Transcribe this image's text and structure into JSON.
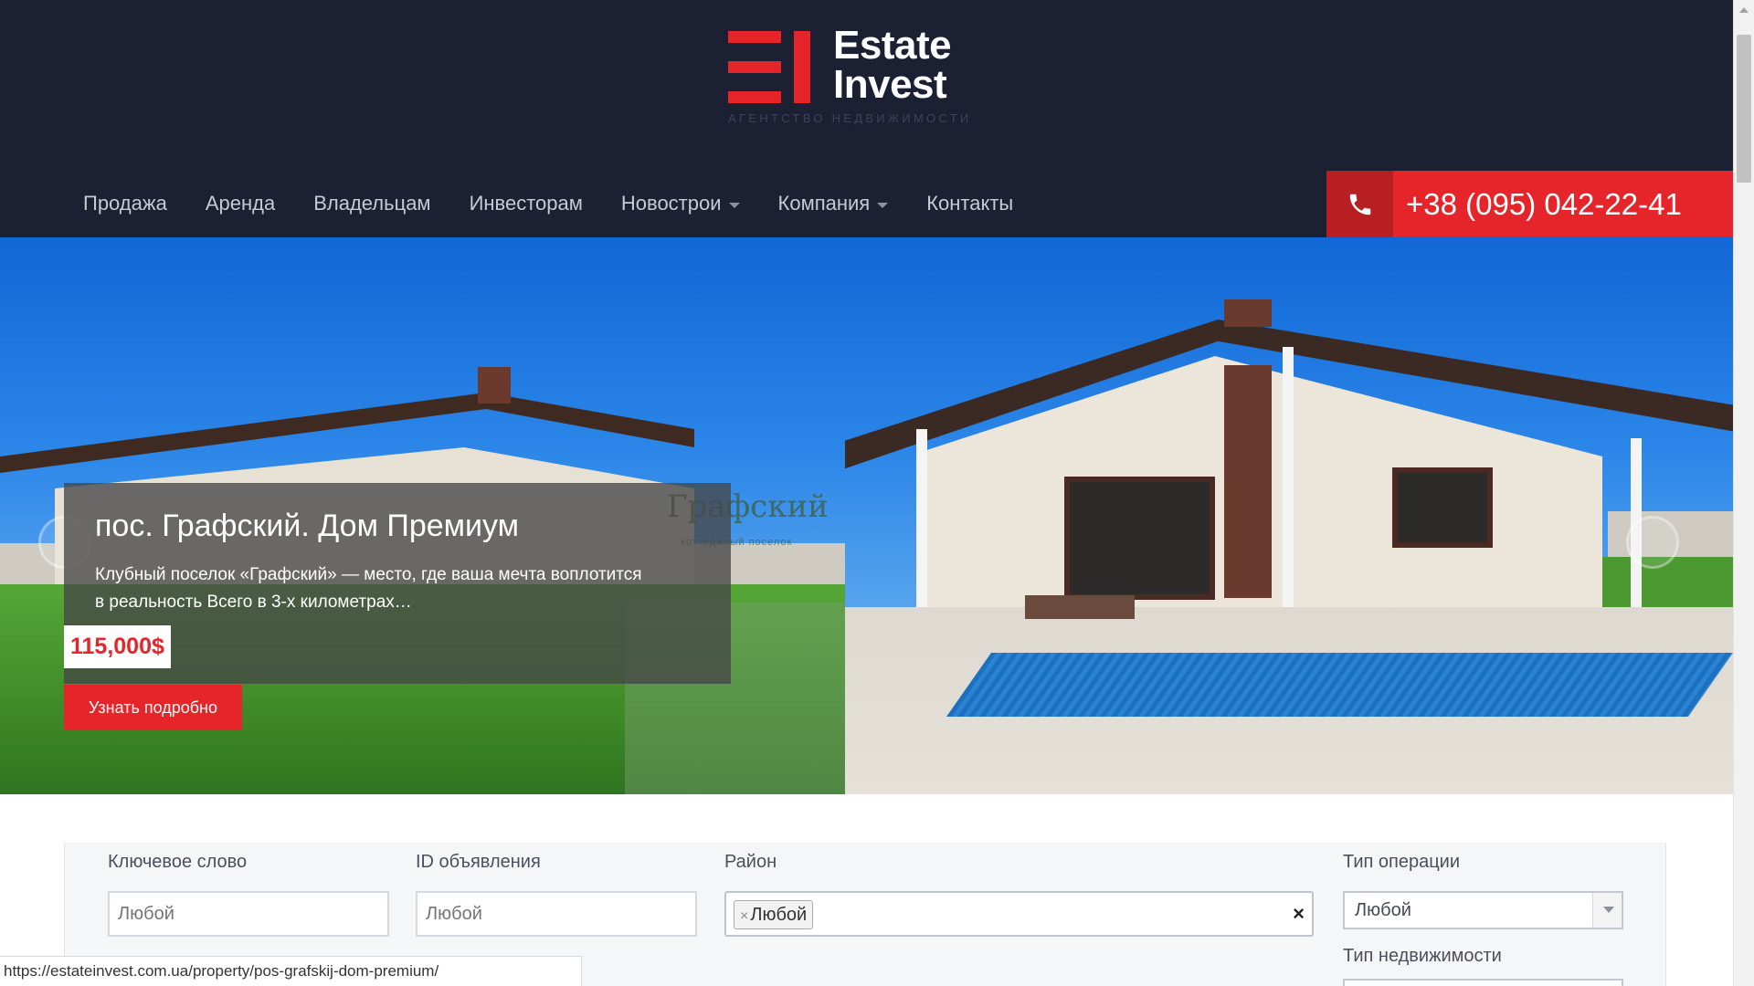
{
  "brand": {
    "name_line1": "Estate",
    "name_line2": "Invest",
    "tagline": "АГЕНТСТВО НЕДВИЖИМОСТИ",
    "accent_color": "#e5252a",
    "header_bg": "#1b2133"
  },
  "nav": {
    "items": [
      {
        "label": "Продажа",
        "has_dropdown": false
      },
      {
        "label": "Аренда",
        "has_dropdown": false
      },
      {
        "label": "Владельцам",
        "has_dropdown": false
      },
      {
        "label": "Инвесторам",
        "has_dropdown": false
      },
      {
        "label": "Новострои",
        "has_dropdown": true
      },
      {
        "label": "Компания",
        "has_dropdown": true
      },
      {
        "label": "Контакты",
        "has_dropdown": false
      }
    ]
  },
  "contact": {
    "phone": "+38 (095) 042-22-41",
    "icon": "phone-icon"
  },
  "slider": {
    "title": "пос. Графский. Дом Премиум",
    "description": "Клубный поселок «Графский» — место, где ваша мечта воплотится в реальность Всего в 3-х километрах…",
    "price": "115,000$",
    "cta_label": "Узнать подробно",
    "watermark_text": "Графский",
    "watermark_sub": "коттеджный поселок"
  },
  "search": {
    "keyword": {
      "label": "Ключевое слово",
      "placeholder": "Любой"
    },
    "listing_id": {
      "label": "ID объявления",
      "placeholder": "Любой"
    },
    "district": {
      "label": "Район",
      "selected_tag": "Любой"
    },
    "operation_type": {
      "label": "Тип операции",
      "selected": "Любой"
    },
    "property_type": {
      "label": "Тип недвижимости"
    }
  },
  "status_bar": {
    "url": "https://estateinvest.com.ua/property/pos-grafskij-dom-premium/"
  }
}
